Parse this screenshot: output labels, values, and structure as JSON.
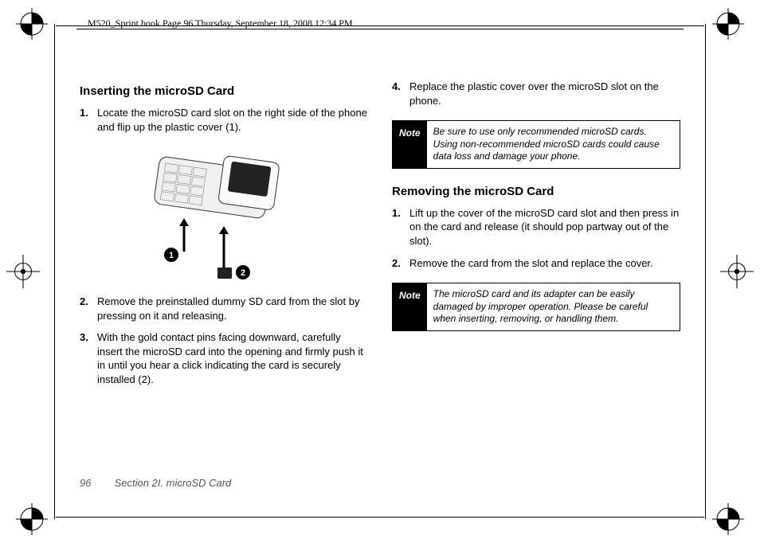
{
  "header": {
    "meta": "M520_Sprint.book  Page 96  Thursday, September 18, 2008  12:34 PM"
  },
  "left_col": {
    "heading": "Inserting the microSD Card",
    "steps": [
      {
        "num": "1.",
        "text": "Locate the microSD card slot on the right side of the phone and flip up the plastic cover (1)."
      },
      {
        "num": "2.",
        "text": "Remove the preinstalled dummy SD card from the slot by pressing on it and releasing."
      },
      {
        "num": "3.",
        "text": "With the gold contact pins facing downward, carefully insert the microSD card into the opening and firmly push it in until you hear a click indicating the card is securely installed (2)."
      }
    ],
    "callout1": "1",
    "callout2": "2"
  },
  "right_col": {
    "step4": {
      "num": "4.",
      "text": "Replace the plastic cover over the microSD slot on the phone."
    },
    "note1_label": "Note",
    "note1_text": "Be sure to use only recommended microSD cards. Using non-recommended microSD cards could cause data loss and damage your phone.",
    "heading": "Removing the microSD Card",
    "steps": [
      {
        "num": "1.",
        "text": "Lift up the cover of the microSD card slot and then press in on the card and release (it should pop partway out of the slot)."
      },
      {
        "num": "2.",
        "text": "Remove the card from the slot and replace the cover."
      }
    ],
    "note2_label": "Note",
    "note2_text": "The microSD card and its adapter can be easily damaged by improper operation. Please be careful when inserting, removing, or handling them."
  },
  "footer": {
    "page": "96",
    "section": "Section 2I. microSD Card"
  }
}
